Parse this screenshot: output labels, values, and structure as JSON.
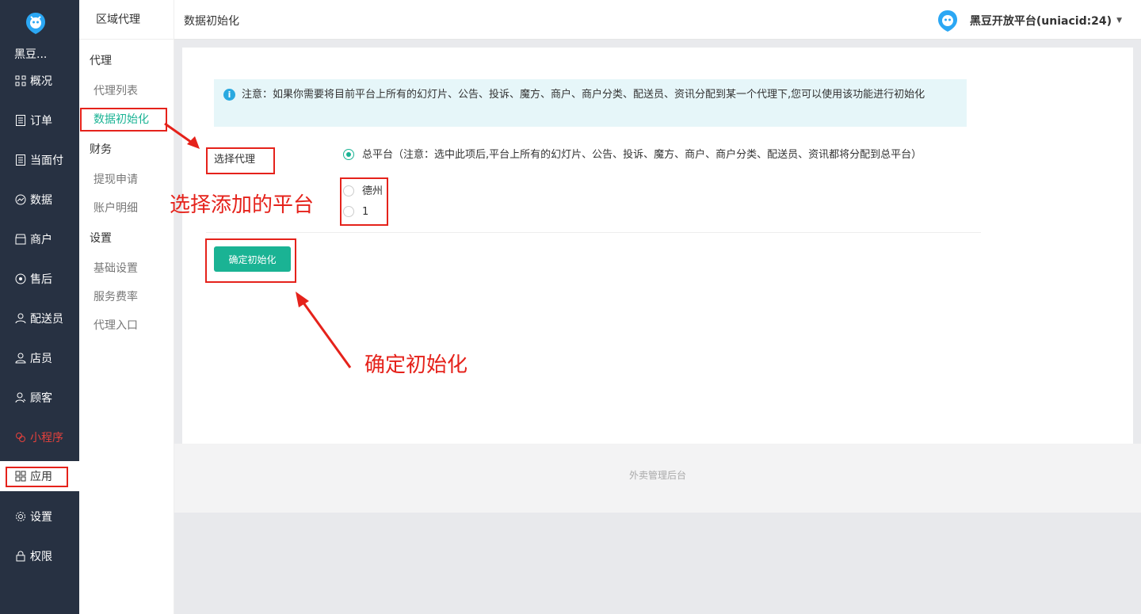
{
  "nav": {
    "brand": "黑豆...",
    "items": [
      {
        "label": "概况",
        "icon": "overview-icon"
      },
      {
        "label": "订单",
        "icon": "order-icon"
      },
      {
        "label": "当面付",
        "icon": "pay-icon"
      },
      {
        "label": "数据",
        "icon": "data-icon"
      },
      {
        "label": "商户",
        "icon": "store-icon"
      },
      {
        "label": "售后",
        "icon": "aftersale-icon"
      },
      {
        "label": "配送员",
        "icon": "courier-icon"
      },
      {
        "label": "店员",
        "icon": "clerk-icon"
      },
      {
        "label": "顾客",
        "icon": "customer-icon"
      },
      {
        "label": "小程序",
        "icon": "miniprogram-icon"
      },
      {
        "label": "应用",
        "icon": "apps-icon"
      },
      {
        "label": "设置",
        "icon": "settings-icon"
      },
      {
        "label": "权限",
        "icon": "lock-icon"
      }
    ]
  },
  "subnav": {
    "head": "区域代理",
    "groups": [
      {
        "title": "代理",
        "items": [
          "代理列表",
          "数据初始化"
        ]
      },
      {
        "title": "财务",
        "items": [
          "提现申请",
          "账户明细"
        ]
      },
      {
        "title": "设置",
        "items": [
          "基础设置",
          "服务费率",
          "代理入口"
        ]
      }
    ]
  },
  "topbar": {
    "title": "数据初始化",
    "account": "黑豆开放平台(uniacid:24)"
  },
  "main": {
    "notice": "注意：如果你需要将目前平台上所有的幻灯片、公告、投诉、魔方、商户、商户分类、配送员、资讯分配到某一个代理下,您可以使用该功能进行初始化",
    "field_label": "选择代理",
    "options": [
      {
        "label": "总平台（注意：选中此项后,平台上所有的幻灯片、公告、投诉、魔方、商户、商户分类、配送员、资讯都将分配到总平台）",
        "checked": true
      },
      {
        "label": "德州",
        "checked": false
      },
      {
        "label": "1",
        "checked": false
      }
    ],
    "submit": "确定初始化"
  },
  "footer": "外卖管理后台",
  "annotations": {
    "select_platform": "选择添加的平台",
    "confirm_init": "确定初始化"
  },
  "colors": {
    "accent": "#1ab394",
    "nav_bg": "#273142",
    "annotation": "#e5221b"
  }
}
